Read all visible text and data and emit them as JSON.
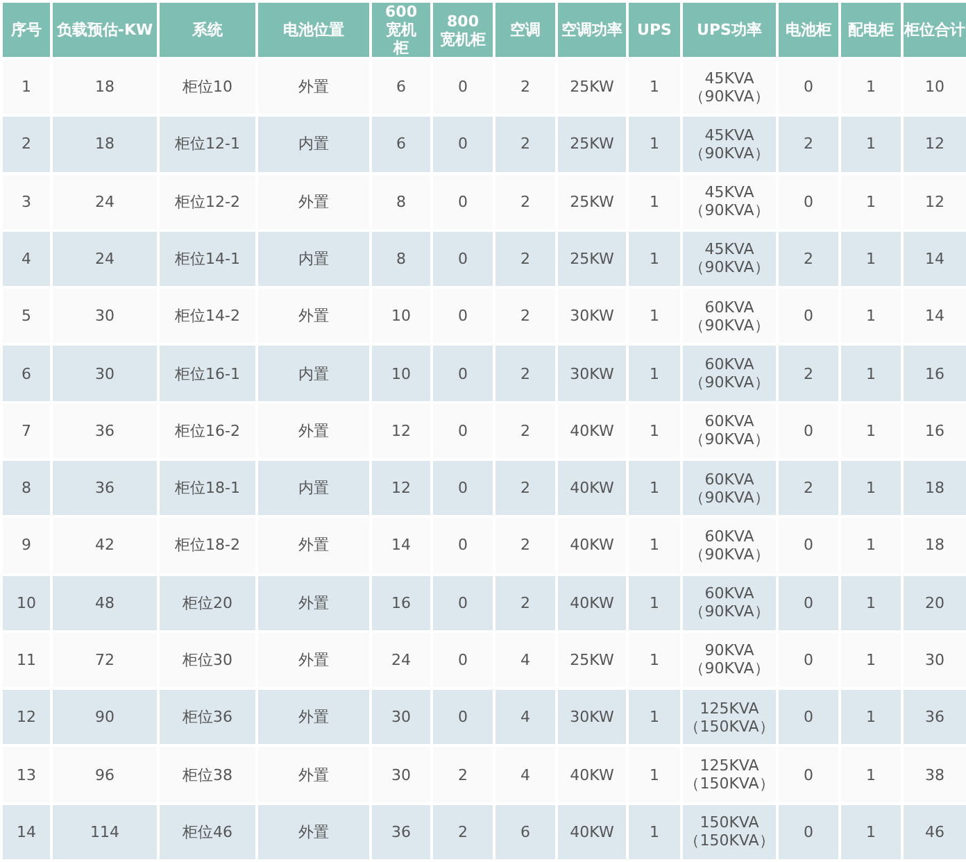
{
  "table": {
    "columns": [
      "序号",
      "负载预估-KW",
      "系统",
      "电池位置",
      "600宽机柜",
      "800宽机柜",
      "空调",
      "空调功率",
      "UPS",
      "UPS功率",
      "电池柜",
      "配电柜",
      "柜位合计"
    ],
    "rows": [
      [
        "1",
        "18",
        "柜位10",
        "外置",
        "6",
        "0",
        "2",
        "25KW",
        "1",
        "45KVA\n（90KVA）",
        "0",
        "1",
        "10"
      ],
      [
        "2",
        "18",
        "柜位12-1",
        "内置",
        "6",
        "0",
        "2",
        "25KW",
        "1",
        "45KVA\n（90KVA）",
        "2",
        "1",
        "12"
      ],
      [
        "3",
        "24",
        "柜位12-2",
        "外置",
        "8",
        "0",
        "2",
        "25KW",
        "1",
        "45KVA\n（90KVA）",
        "0",
        "1",
        "12"
      ],
      [
        "4",
        "24",
        "柜位14-1",
        "内置",
        "8",
        "0",
        "2",
        "25KW",
        "1",
        "45KVA\n（90KVA）",
        "2",
        "1",
        "14"
      ],
      [
        "5",
        "30",
        "柜位14-2",
        "外置",
        "10",
        "0",
        "2",
        "30KW",
        "1",
        "60KVA\n（90KVA）",
        "0",
        "1",
        "14"
      ],
      [
        "6",
        "30",
        "柜位16-1",
        "内置",
        "10",
        "0",
        "2",
        "30KW",
        "1",
        "60KVA\n（90KVA）",
        "2",
        "1",
        "16"
      ],
      [
        "7",
        "36",
        "柜位16-2",
        "外置",
        "12",
        "0",
        "2",
        "40KW",
        "1",
        "60KVA\n（90KVA）",
        "0",
        "1",
        "16"
      ],
      [
        "8",
        "36",
        "柜位18-1",
        "内置",
        "12",
        "0",
        "2",
        "40KW",
        "1",
        "60KVA\n（90KVA）",
        "2",
        "1",
        "18"
      ],
      [
        "9",
        "42",
        "柜位18-2",
        "外置",
        "14",
        "0",
        "2",
        "40KW",
        "1",
        "60KVA\n（90KVA）",
        "0",
        "1",
        "18"
      ],
      [
        "10",
        "48",
        "柜位20",
        "外置",
        "16",
        "0",
        "2",
        "40KW",
        "1",
        "60KVA\n（90KVA）",
        "0",
        "1",
        "20"
      ],
      [
        "11",
        "72",
        "柜位30",
        "外置",
        "24",
        "0",
        "4",
        "25KW",
        "1",
        "90KVA\n（90KVA）",
        "0",
        "1",
        "30"
      ],
      [
        "12",
        "90",
        "柜位36",
        "外置",
        "30",
        "0",
        "4",
        "30KW",
        "1",
        "125KVA\n（150KVA）",
        "0",
        "1",
        "36"
      ],
      [
        "13",
        "96",
        "柜位38",
        "外置",
        "30",
        "2",
        "4",
        "40KW",
        "1",
        "125KVA\n（150KVA）",
        "0",
        "1",
        "38"
      ],
      [
        "14",
        "114",
        "柜位46",
        "外置",
        "36",
        "2",
        "6",
        "40KW",
        "1",
        "150KVA\n（150KVA）",
        "0",
        "1",
        "46"
      ]
    ]
  }
}
